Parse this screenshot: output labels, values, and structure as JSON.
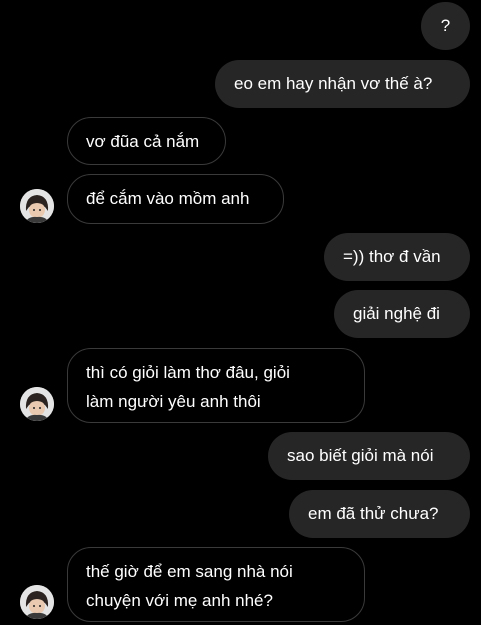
{
  "chat": {
    "messages": [
      {
        "side": "sent",
        "text": "?"
      },
      {
        "side": "sent",
        "text": "eo em hay nhận vơ thế à?"
      },
      {
        "side": "received",
        "text": "vơ đũa cả nắm"
      },
      {
        "side": "received",
        "text": "để cắm vào mồm anh"
      },
      {
        "side": "sent",
        "text": "=)) thơ đ vần"
      },
      {
        "side": "sent",
        "text": "giải nghệ đi"
      },
      {
        "side": "received",
        "text": "thì có giỏi làm thơ đâu, giỏi\nlàm người yêu anh thôi"
      },
      {
        "side": "sent",
        "text": "sao biết giỏi mà nói"
      },
      {
        "side": "sent",
        "text": "em đã thử chưa?"
      },
      {
        "side": "received",
        "text": "thế giờ để em sang nhà nói\nchuyện với mẹ anh nhé?"
      }
    ],
    "contact_avatar": "avatar-photo"
  },
  "colors": {
    "background": "#000000",
    "sent_bubble": "#262626",
    "received_border": "#3a3a3a",
    "text": "#ffffff"
  }
}
